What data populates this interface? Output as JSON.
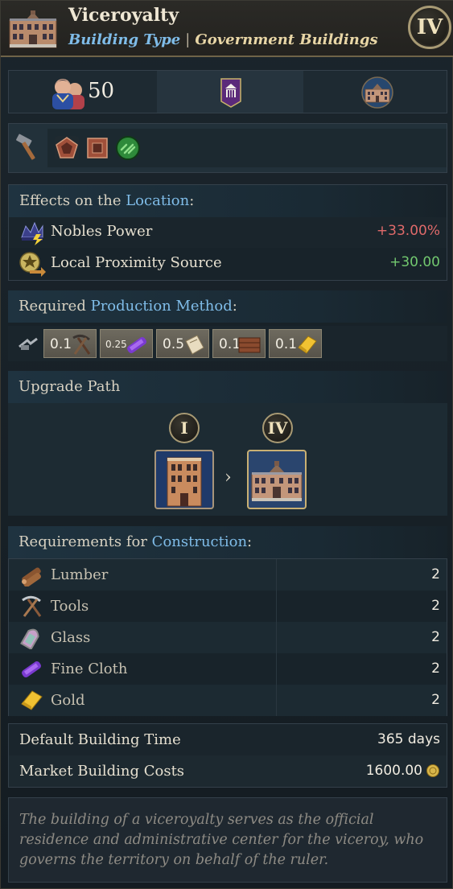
{
  "header": {
    "title": "Viceroyalty",
    "type_key": "Building Type",
    "separator": "|",
    "type_value": "Government Buildings",
    "tier": "IV",
    "icon": "building-icon"
  },
  "stats": {
    "pop_icon": "population-icon",
    "pop_value": "50",
    "government_icon": "government-banner-icon",
    "building_icon": "building-icon"
  },
  "tags": {
    "icons": [
      "hammer-icon",
      "pentagon-icon",
      "square-icon",
      "green-seal-icon"
    ]
  },
  "effects": {
    "heading_prefix": "Effects on the ",
    "heading_link": "Location",
    "heading_suffix": ":",
    "rows": [
      {
        "label": "Nobles Power",
        "value": "+33.00%",
        "icon": "nobles-power-icon"
      },
      {
        "label": "Local Proximity Source",
        "value": "+30.00",
        "icon": "proximity-source-icon"
      }
    ]
  },
  "production": {
    "heading_prefix": "Required ",
    "heading_link": "Production Method",
    "heading_suffix": ":",
    "icon": "production-method-icon",
    "inputs": [
      {
        "amount": "0.1",
        "icon": "tools-icon"
      },
      {
        "amount": "0.25",
        "icon": "fine-cloth-icon"
      },
      {
        "amount": "0.5",
        "icon": "paper-icon"
      },
      {
        "amount": "0.1",
        "icon": "lumber-icon"
      },
      {
        "amount": "0.1",
        "icon": "gold-icon"
      }
    ]
  },
  "upgrade": {
    "heading": "Upgrade Path",
    "from_tier": "I",
    "to_tier": "IV",
    "arrow": "›"
  },
  "construction": {
    "heading_prefix": "Requirements for ",
    "heading_link": "Construction",
    "heading_suffix": ":",
    "rows": [
      {
        "label": "Lumber",
        "qty": "2",
        "icon": "lumber-icon"
      },
      {
        "label": "Tools",
        "qty": "2",
        "icon": "tools-icon"
      },
      {
        "label": "Glass",
        "qty": "2",
        "icon": "glass-icon"
      },
      {
        "label": "Fine Cloth",
        "qty": "2",
        "icon": "fine-cloth-icon"
      },
      {
        "label": "Gold",
        "qty": "2",
        "icon": "gold-icon"
      }
    ]
  },
  "timing": {
    "time_label": "Default Building Time",
    "time_value": "365 days",
    "cost_label": "Market Building Costs",
    "cost_value": "1600.00",
    "cost_icon": "coin-icon"
  },
  "description": "The building of a viceroyalty serves as the official residence and administrative center for the viceroy, who governs the territory on behalf of the ruler."
}
